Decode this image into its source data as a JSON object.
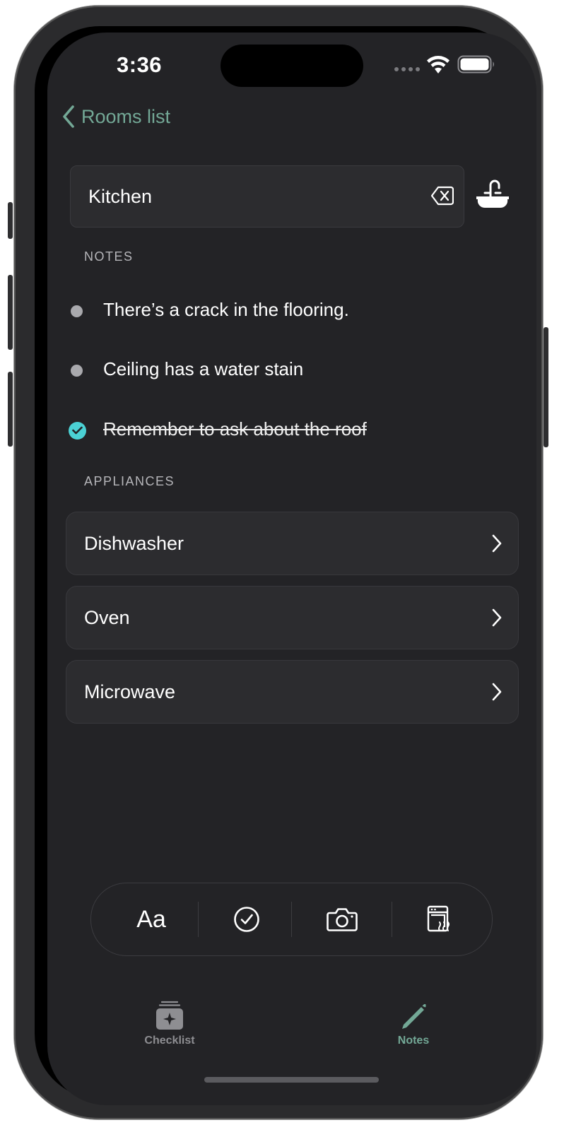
{
  "status_bar": {
    "time": "3:36"
  },
  "nav": {
    "back_label": "Rooms list"
  },
  "room": {
    "title": "Kitchen"
  },
  "notes_section": {
    "header": "NOTES",
    "items": [
      {
        "text": "There’s a crack in the flooring.",
        "done": false
      },
      {
        "text": "Ceiling has a water stain",
        "done": false
      },
      {
        "text": "Remember to ask about the roof",
        "done": true
      }
    ]
  },
  "appliances_section": {
    "header": "APPLIANCES",
    "items": [
      {
        "label": "Dishwasher"
      },
      {
        "label": "Oven"
      },
      {
        "label": "Microwave"
      }
    ]
  },
  "toolbar": {
    "text_format_label": "Aa",
    "icons": [
      "text-format-icon",
      "checkmark-circle-icon",
      "camera-icon",
      "appliance-icon"
    ]
  },
  "tabs": [
    {
      "label": "Checklist",
      "icon": "checklist-icon",
      "selected": false
    },
    {
      "label": "Notes",
      "icon": "pencil-icon",
      "selected": true
    }
  ],
  "colors": {
    "accent": "#73a896",
    "check": "#4bd1d4",
    "background": "#232326",
    "card": "#2c2c2f"
  }
}
